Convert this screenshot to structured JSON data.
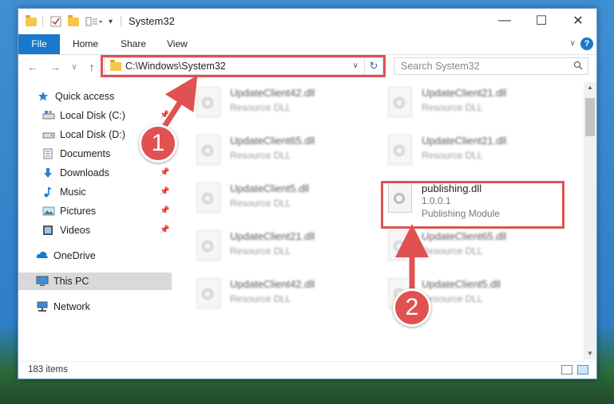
{
  "window": {
    "title": "System32",
    "minimize_glyph": "—",
    "maximize_glyph": "☐",
    "close_glyph": "✕"
  },
  "ribbon": {
    "tabs": [
      "File",
      "Home",
      "Share",
      "View"
    ],
    "help_glyph": "?"
  },
  "nav": {
    "back_glyph": "←",
    "forward_glyph": "→",
    "recent_glyph": "∨",
    "up_glyph": "↑",
    "address_path": "C:\\Windows\\System32",
    "search_placeholder": "Search System32"
  },
  "sidebar": {
    "items": [
      {
        "label": "Quick access",
        "icon": "star-icon"
      },
      {
        "label": "Local Disk (C:)",
        "icon": "drive-icon"
      },
      {
        "label": "Local Disk (D:)",
        "icon": "drive-icon"
      },
      {
        "label": "Documents",
        "icon": "documents-icon"
      },
      {
        "label": "Downloads",
        "icon": "download-icon"
      },
      {
        "label": "Music",
        "icon": "music-icon"
      },
      {
        "label": "Pictures",
        "icon": "pictures-icon"
      },
      {
        "label": "Videos",
        "icon": "videos-icon"
      },
      {
        "label": "OneDrive",
        "icon": "cloud-icon"
      },
      {
        "label": "This PC",
        "icon": "computer-icon"
      },
      {
        "label": "Network",
        "icon": "network-icon"
      }
    ]
  },
  "files": [
    {
      "name": "UpdateClient42.dll",
      "type": "Resource DLL"
    },
    {
      "name": "UpdateClient21.dll",
      "type": "Resource DLL"
    },
    {
      "name": "UpdateClient65.dll",
      "type": "Resource DLL"
    },
    {
      "name": "UpdateClient21.dll",
      "type": "Resource DLL"
    },
    {
      "name": "UpdateClient5.dll",
      "type": "Resource DLL"
    },
    {
      "name": "publishing.dll",
      "version": "1.0.0.1",
      "type": "Publishing Module"
    },
    {
      "name": "UpdateClient21.dll",
      "type": "Resource DLL"
    },
    {
      "name": "UpdateClient65.dll",
      "type": "Resource DLL"
    },
    {
      "name": "UpdateClient42.dll",
      "type": "Resource DLL"
    },
    {
      "name": "UpdateClient5.dll",
      "type": "Resource DLL"
    }
  ],
  "status": {
    "item_count": "183 items"
  },
  "annotations": {
    "step1": "1",
    "step2": "2",
    "color": "#e05252"
  }
}
